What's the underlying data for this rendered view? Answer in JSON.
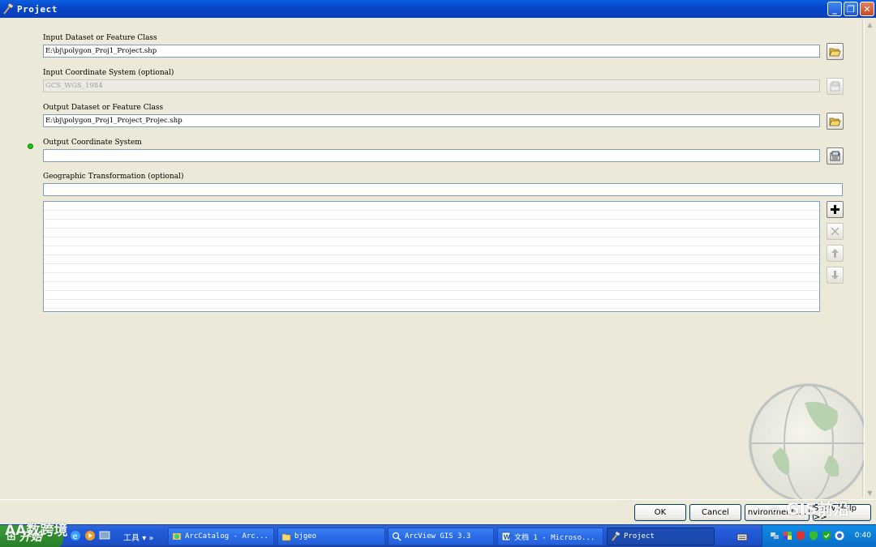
{
  "window": {
    "title": "Project"
  },
  "form": {
    "input_dataset": {
      "label": "Input Dataset or Feature Class",
      "value": "E:\\bj\\polygon_Proj1_Project.shp"
    },
    "input_coord": {
      "label": "Input Coordinate System (optional)",
      "value": "GCS_WGS_1984"
    },
    "output_dataset": {
      "label": "Output Dataset or Feature Class",
      "value": "E:\\bj\\polygon_Proj1_Project_Projec.shp"
    },
    "output_coord": {
      "label": "Output Coordinate System",
      "value": ""
    },
    "geo_transform": {
      "label": "Geographic Transformation (optional)",
      "value": ""
    }
  },
  "buttons": {
    "ok": "OK",
    "cancel": "Cancel",
    "env": "nvironments...",
    "help": "Show Help >>"
  },
  "taskbar": {
    "start": "开始",
    "tools": "工具",
    "tasks": [
      {
        "label": "ArcCatalog - Arc...",
        "active": false
      },
      {
        "label": "bjgeo",
        "active": false
      },
      {
        "label": "ArcView GIS 3.3",
        "active": false
      },
      {
        "label": "文档 1 - Microso...",
        "active": false
      },
      {
        "label": "Project",
        "active": true
      }
    ],
    "clock": "0:40"
  },
  "watermarks": {
    "left": "AA数跨境",
    "right": "GIS前沿"
  },
  "colors": {
    "title_bar": "#0a4fd0",
    "dialog_bg": "#ece9d8",
    "required_dot": "#19c219",
    "taskbar": "#245edb",
    "start_button": "#2f8a2f"
  }
}
